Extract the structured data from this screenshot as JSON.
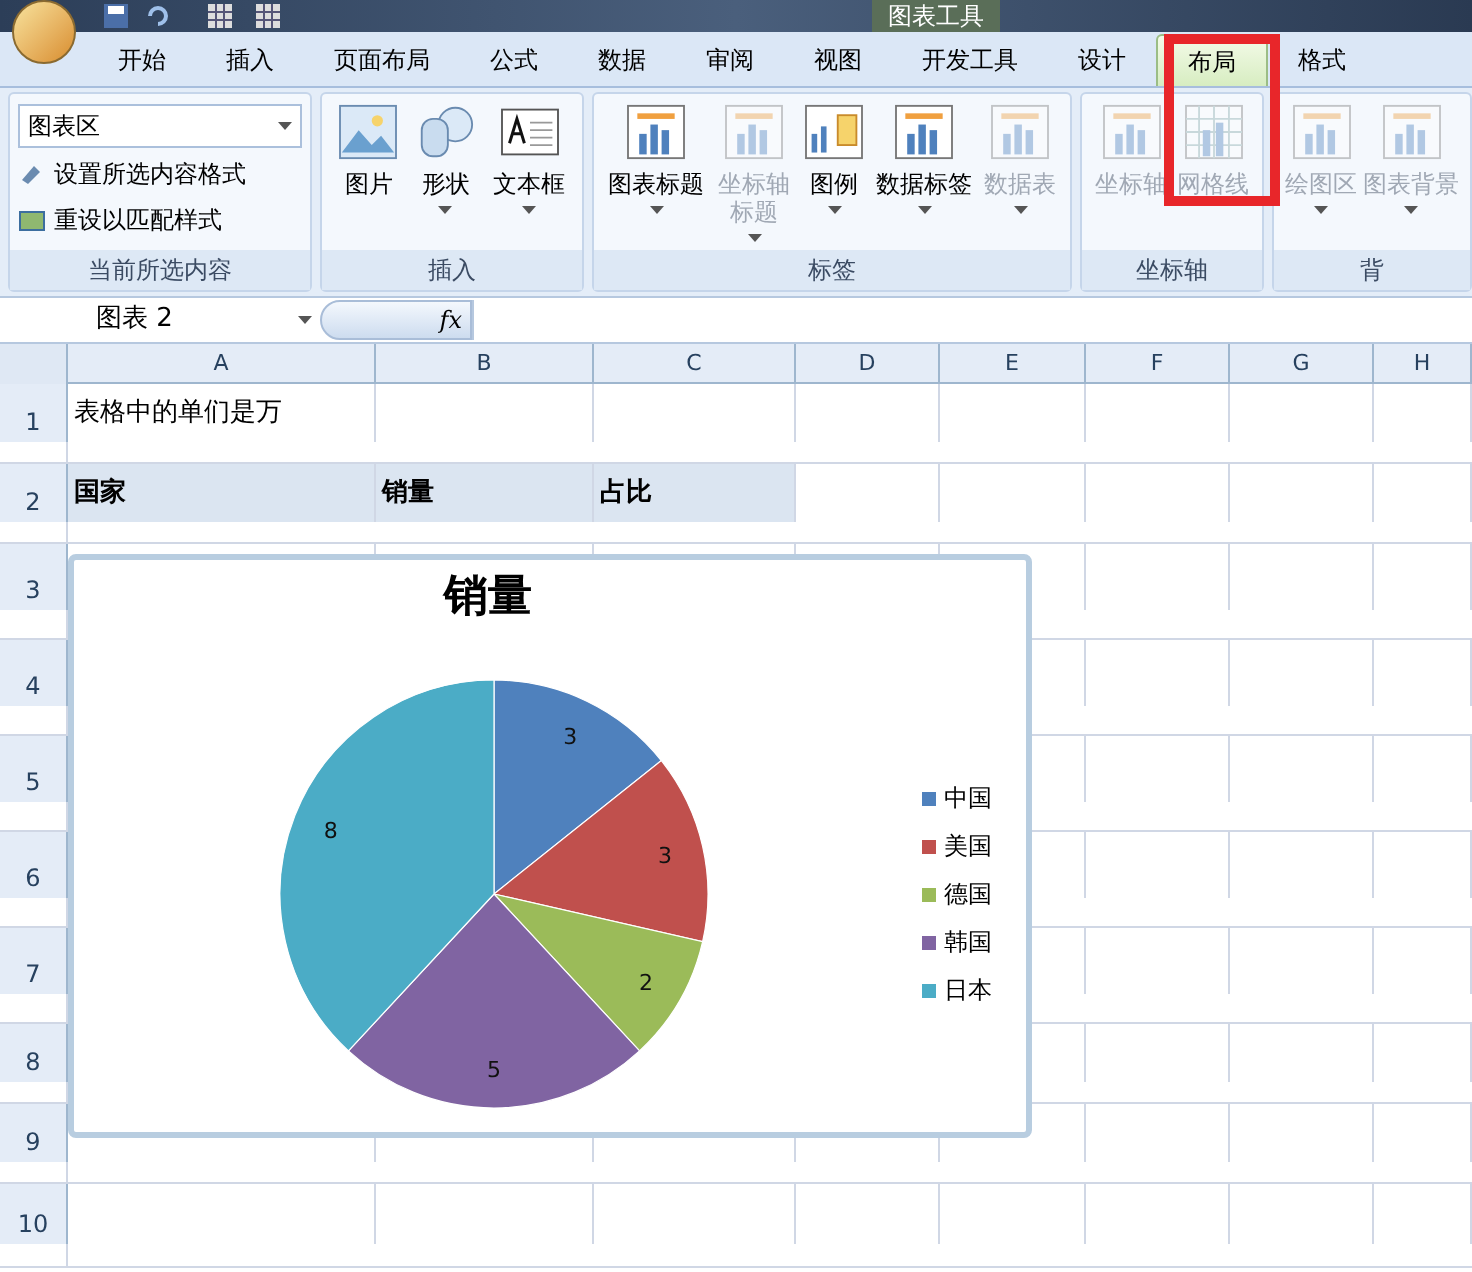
{
  "title_bar": {
    "context_title": "图表工具"
  },
  "tabs": [
    {
      "label": "开始",
      "selected": false
    },
    {
      "label": "插入",
      "selected": false
    },
    {
      "label": "页面布局",
      "selected": false
    },
    {
      "label": "公式",
      "selected": false
    },
    {
      "label": "数据",
      "selected": false
    },
    {
      "label": "审阅",
      "selected": false
    },
    {
      "label": "视图",
      "selected": false
    },
    {
      "label": "开发工具",
      "selected": false
    },
    {
      "label": "设计",
      "selected": false
    },
    {
      "label": "布局",
      "selected": true
    },
    {
      "label": "格式",
      "selected": false
    }
  ],
  "ribbon": {
    "groups": [
      {
        "kind": "selection",
        "label": "当前所选内容",
        "dropdown": "图表区",
        "commands": [
          "设置所选内容格式",
          "重设以匹配样式"
        ]
      },
      {
        "kind": "buttons",
        "label": "插入",
        "buttons": [
          {
            "label": "图片",
            "dropdown": false,
            "disabled": false
          },
          {
            "label": "形状",
            "dropdown": true,
            "disabled": false
          },
          {
            "label": "文本框",
            "dropdown": true,
            "disabled": false
          }
        ]
      },
      {
        "kind": "buttons",
        "label": "标签",
        "buttons": [
          {
            "label": "图表标题",
            "dropdown": true,
            "disabled": false
          },
          {
            "label": "坐标轴标题",
            "dropdown": true,
            "disabled": true
          },
          {
            "label": "图例",
            "dropdown": true,
            "disabled": false
          },
          {
            "label": "数据标签",
            "dropdown": true,
            "disabled": false
          },
          {
            "label": "数据表",
            "dropdown": true,
            "disabled": true
          }
        ]
      },
      {
        "kind": "buttons",
        "label": "坐标轴",
        "buttons": [
          {
            "label": "坐标轴",
            "dropdown": false,
            "disabled": true
          },
          {
            "label": "网格线",
            "dropdown": false,
            "disabled": true
          }
        ]
      },
      {
        "kind": "buttons",
        "label": "背",
        "buttons": [
          {
            "label": "绘图区",
            "dropdown": true,
            "disabled": true
          },
          {
            "label": "图表背景",
            "dropdown": true,
            "disabled": true
          }
        ]
      }
    ]
  },
  "formula_bar": {
    "name_box": "图表 2",
    "fx": "fx"
  },
  "sheet": {
    "columns": [
      "A",
      "B",
      "C",
      "D",
      "E",
      "F",
      "G",
      "H"
    ],
    "rows": [
      {
        "header": "1",
        "highlighted": false,
        "cells": [
          {
            "text": "表格中的单们是万",
            "bold": false
          }
        ]
      },
      {
        "header": "2",
        "highlighted": true,
        "cells": [
          {
            "text": "国家",
            "bold": true
          },
          {
            "text": "销量",
            "bold": true
          },
          {
            "text": "占比",
            "bold": true
          }
        ]
      },
      {
        "header": "3",
        "highlighted": false,
        "cells": []
      },
      {
        "header": "4",
        "highlighted": false,
        "cells": []
      },
      {
        "header": "5",
        "highlighted": false,
        "cells": []
      },
      {
        "header": "6",
        "highlighted": false,
        "cells": []
      },
      {
        "header": "7",
        "highlighted": false,
        "cells": []
      },
      {
        "header": "8",
        "highlighted": false,
        "cells": []
      },
      {
        "header": "9",
        "highlighted": false,
        "cells": []
      },
      {
        "header": "10",
        "highlighted": false,
        "cells": []
      }
    ]
  },
  "chart": {
    "chart_data": {
      "type": "pie",
      "title": "销量",
      "categories": [
        "中国",
        "美国",
        "德国",
        "韩国",
        "日本"
      ],
      "values": [
        3,
        3,
        2,
        5,
        8
      ],
      "data_labels": true
    }
  }
}
